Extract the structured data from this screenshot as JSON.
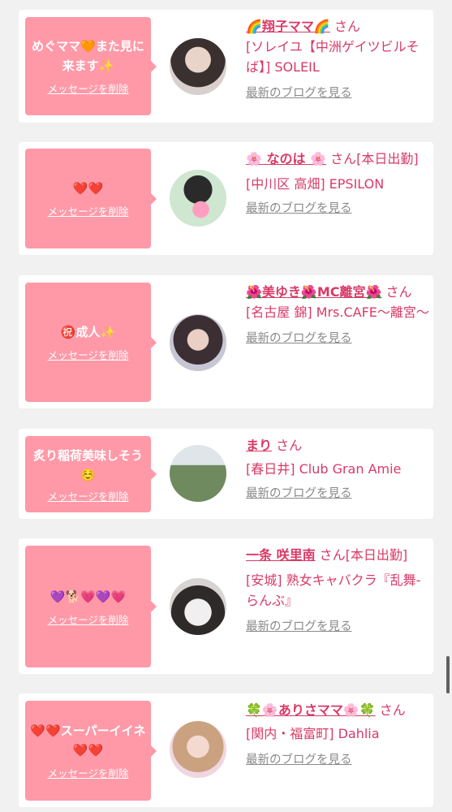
{
  "common": {
    "delete_label": "メッセージを削除",
    "blog_label": "最新のブログを見る",
    "accent_color": "#ff99a8",
    "name_color": "#d83a67"
  },
  "cards": [
    {
      "message": "めぐママ🧡また見に来ます✨",
      "name": "🌈翔子ママ🌈",
      "san": "さん",
      "shop": "[ソレイユ【中洲ゲイツビルそば】] SOLEIL"
    },
    {
      "message": "❤️❤️",
      "name": "🌸 なのは 🌸",
      "san": "さん[本日出勤]",
      "shop": "[中川区 高畑] EPSILON"
    },
    {
      "message": "㊗️成人✨",
      "name": "🌺美ゆき🌺MC離宮🌺",
      "san": "さん",
      "shop": "[名古屋 錦] Mrs.CAFE〜離宮〜"
    },
    {
      "message": "炙り稲荷美味しそう☺️",
      "name": "まり",
      "san": "さん",
      "shop": "[春日井] Club Gran Amie"
    },
    {
      "message": "💜🐕💗💜💗",
      "name": "一条 咲里南",
      "san": "さん[本日出勤]",
      "shop": "[安城] 熟女キャバクラ『乱舞-らんぶ』"
    },
    {
      "message": "❤️❤️スーパーイイネ❤️❤️",
      "name": "🍀🌸ありさママ🌸🍀",
      "san": "さん",
      "shop": "[関内・福富町] Dahlia"
    }
  ]
}
